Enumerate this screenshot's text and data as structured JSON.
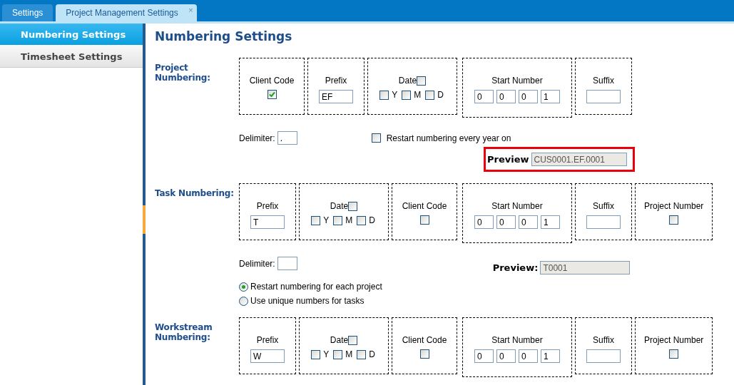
{
  "tabs": [
    {
      "label": "Settings",
      "selected": false
    },
    {
      "label": "Project Management Settings",
      "selected": true,
      "close": "×"
    }
  ],
  "sidebar": {
    "items": [
      {
        "label": "Numbering Settings",
        "selected": true
      },
      {
        "label": "Timesheet Settings",
        "selected": false
      }
    ]
  },
  "title": "Numbering Settings",
  "sections": [
    {
      "label": "Project Numbering:",
      "fields": [
        {
          "kind": "checkbox",
          "label": "Client Code",
          "checked": true
        },
        {
          "kind": "text",
          "label": "Prefix",
          "value": "EF"
        },
        {
          "kind": "date",
          "label": "Date",
          "checked": false,
          "parts": [
            {
              "label": "Y",
              "checked": false
            },
            {
              "label": "M",
              "checked": false
            },
            {
              "label": "D",
              "checked": false
            }
          ]
        },
        {
          "kind": "digits",
          "label": "Start Number",
          "digits": [
            "0",
            "0",
            "0",
            "1"
          ]
        },
        {
          "kind": "text",
          "label": "Suffix"
        }
      ],
      "delimiter": {
        "label": "Delimiter:",
        "value": "."
      },
      "restart_option": {
        "label": "Restart numbering every year on",
        "checked": false
      },
      "preview": {
        "label": "Preview",
        "value": "CUS0001.EF.0001",
        "highlighted": true
      }
    },
    {
      "label": "Task Numbering:",
      "fields": [
        {
          "kind": "text",
          "label": "Prefix",
          "value": "T"
        },
        {
          "kind": "date",
          "label": "Date",
          "checked": false,
          "parts": [
            {
              "label": "Y",
              "checked": false
            },
            {
              "label": "M",
              "checked": false
            },
            {
              "label": "D",
              "checked": false
            }
          ]
        },
        {
          "kind": "checkbox",
          "label": "Client Code",
          "checked": false
        },
        {
          "kind": "digits",
          "label": "Start Number",
          "digits": [
            "0",
            "0",
            "0",
            "1"
          ]
        },
        {
          "kind": "text",
          "label": "Suffix"
        },
        {
          "kind": "checkbox",
          "label": "Project Number",
          "checked": false
        }
      ],
      "delimiter": {
        "label": "Delimiter:"
      },
      "preview": {
        "label": "Preview:",
        "value": "T0001",
        "highlighted": false
      },
      "numbering_mode": [
        {
          "label": "Restart numbering for each project",
          "selected": true
        },
        {
          "label": "Use unique numbers for tasks",
          "selected": false
        }
      ]
    },
    {
      "label": "Workstream Numbering:",
      "fields": [
        {
          "kind": "text",
          "label": "Prefix",
          "value": "W"
        },
        {
          "kind": "date",
          "label": "Date",
          "checked": false,
          "parts": [
            {
              "label": "Y",
              "checked": false
            },
            {
              "label": "M",
              "checked": false
            },
            {
              "label": "D",
              "checked": false
            }
          ]
        },
        {
          "kind": "checkbox",
          "label": "Client Code",
          "checked": false
        },
        {
          "kind": "digits",
          "label": "Start Number",
          "digits": [
            "0",
            "0",
            "0",
            "1"
          ]
        },
        {
          "kind": "text",
          "label": "Suffix"
        },
        {
          "kind": "checkbox",
          "label": "Project Number",
          "checked": false
        }
      ]
    }
  ]
}
